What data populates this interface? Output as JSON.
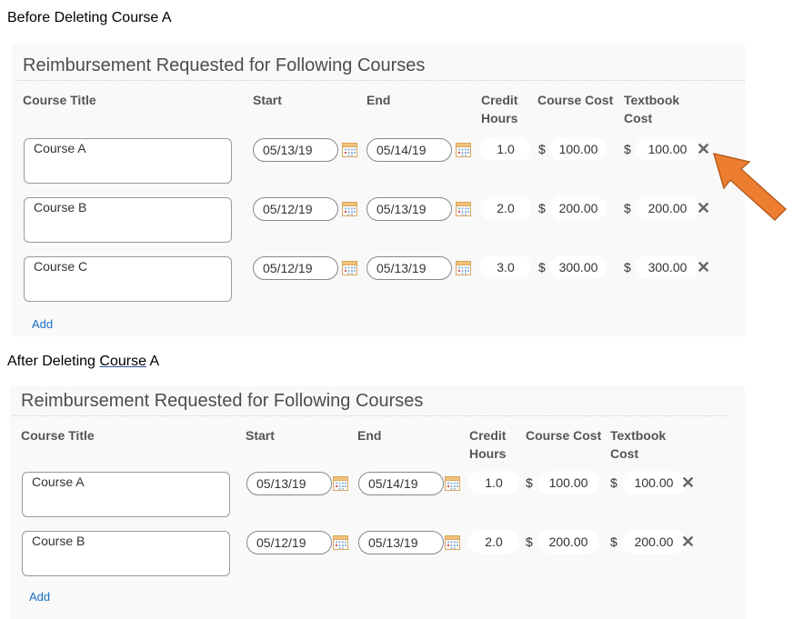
{
  "captions": {
    "before": "Before Deleting Course A",
    "after_prefix": "After Deleting ",
    "after_underlined": "Course",
    "after_suffix": " A"
  },
  "panel_title": "Reimbursement Requested for Following Courses",
  "headers": {
    "course_title": "Course Title",
    "start": "Start",
    "end": "End",
    "credit_line1": "Credit",
    "credit_line2": "Hours",
    "course_cost": "Course Cost",
    "textbook_line1": "Textbook",
    "textbook_line2": "Cost"
  },
  "currency_symbol": "$",
  "delete_glyph": "✕",
  "add_label": "Add",
  "before": {
    "rows": [
      {
        "title": "Course A",
        "start": "05/13/19",
        "end": "05/14/19",
        "credit": "1.0",
        "cost": "100.00",
        "textbook": "100.00"
      },
      {
        "title": "Course B",
        "start": "05/12/19",
        "end": "05/13/19",
        "credit": "2.0",
        "cost": "200.00",
        "textbook": "200.00"
      },
      {
        "title": "Course C",
        "start": "05/12/19",
        "end": "05/13/19",
        "credit": "3.0",
        "cost": "300.00",
        "textbook": "300.00"
      }
    ]
  },
  "after": {
    "rows": [
      {
        "title": "Course A",
        "start": "05/13/19",
        "end": "05/14/19",
        "credit": "1.0",
        "cost": "100.00",
        "textbook": "100.00"
      },
      {
        "title": "Course B",
        "start": "05/12/19",
        "end": "05/13/19",
        "credit": "2.0",
        "cost": "200.00",
        "textbook": "200.00"
      }
    ]
  },
  "colors": {
    "arrow": "#ed7d31",
    "link": "#1a6fc4"
  },
  "icons": {
    "calendar": "calendar-icon",
    "delete": "close-icon",
    "annotation": "arrow-icon"
  }
}
